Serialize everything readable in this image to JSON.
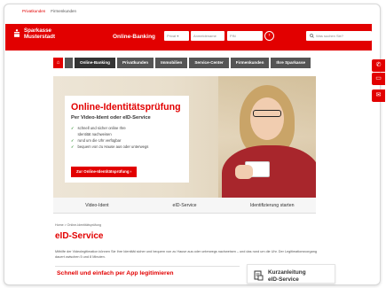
{
  "topnav": {
    "items": [
      "Privatkunden",
      "Firmenkunden"
    ]
  },
  "header": {
    "logo_line1": "Sparkasse",
    "logo_line2": "Musterstadt",
    "online_banking_label": "Online-Banking",
    "login_type": "Privat",
    "username_placeholder": "Anmeldename",
    "pin_placeholder": "PIN",
    "search_placeholder": "Was suchen Sie?"
  },
  "menu": {
    "items": [
      "Online-Banking",
      "Privatkunden",
      "Immobilien",
      "Service-Center",
      "Firmenkunden",
      "Ihre Sparkasse"
    ]
  },
  "hero": {
    "title": "Online-Identitätsprüfung",
    "subtitle": "Per Video-Ident oder eID-Service",
    "bullets": [
      "schnell und sicher online Ihre",
      "Identität nachweisen",
      "rund um die Uhr verfügbar",
      "bequem von zu Hause aus oder unterwegs"
    ],
    "cta": "Zur Online-Identitätsprüfung"
  },
  "tabs": [
    "Video-Ident",
    "eID-Service",
    "Identifizierung starten"
  ],
  "breadcrumb": "Home  >  Online-Identitätsprüfung",
  "page_title": "eID-Service",
  "intro": "Mithilfe der Videolegitimation können Sie Ihre Identität sicher und bequem von zu Hause aus oder unterwegs nachweisen – und das rund um die Uhr. Der Legitimationsvorgang dauert zwischen 5 und 8 Minuten.",
  "section_title": "Schnell und einfach per App legitimieren",
  "side_card": {
    "line1": "Kurzanleitung",
    "line2": "eID-Service"
  },
  "colors": {
    "brand_red": "#e20000",
    "menu_dark": "#555555"
  }
}
